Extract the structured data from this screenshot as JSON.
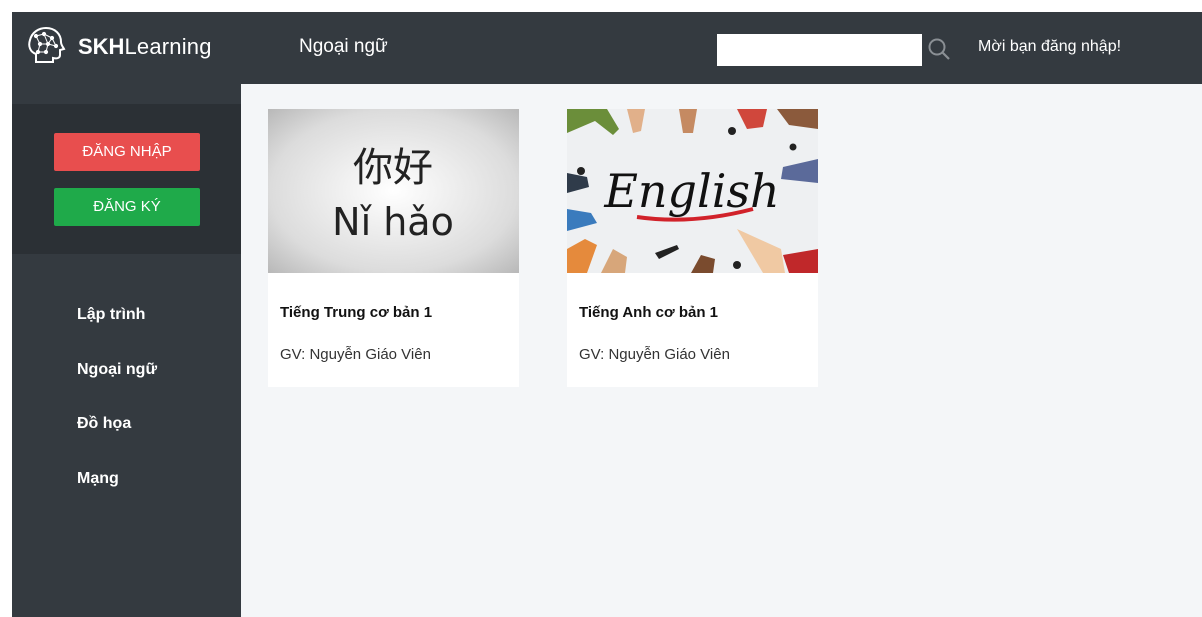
{
  "header": {
    "brand_bold": "SKH",
    "brand_rest": "Learning",
    "page_title": "Ngoại ngữ",
    "search": {
      "value": "",
      "placeholder": ""
    },
    "login_prompt": "Mời bạn đăng nhập!"
  },
  "sidebar": {
    "login_label": "ĐĂNG NHẬP",
    "register_label": "ĐĂNG KÝ",
    "items": [
      {
        "label": "Lập trình"
      },
      {
        "label": "Ngoại ngữ"
      },
      {
        "label": "Đồ họa"
      },
      {
        "label": "Mạng"
      }
    ]
  },
  "courses": [
    {
      "title": "Tiếng Trung cơ bản 1",
      "teacher": "GV: Nguyễn Giáo Viên",
      "thumb_line1": "你好",
      "thumb_line2": "Nǐ hǎo"
    },
    {
      "title": "Tiếng Anh cơ bản 1",
      "teacher": "GV: Nguyễn Giáo Viên",
      "thumb_text": "English"
    }
  ],
  "colors": {
    "dark": "#343a40",
    "login_button": "#e84e4e",
    "register_button": "#1faa4a",
    "content_bg": "#f4f6f8"
  },
  "icons": {
    "logo": "brain-head-icon",
    "search": "search-icon"
  }
}
